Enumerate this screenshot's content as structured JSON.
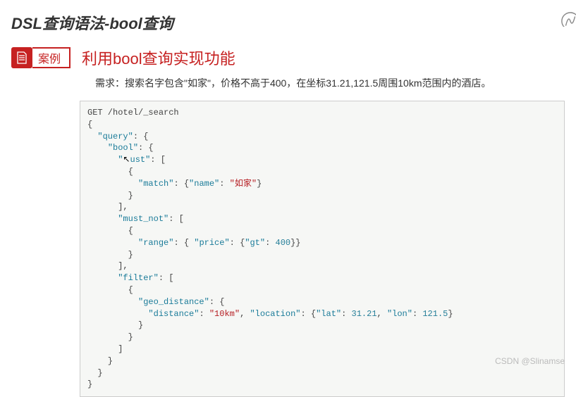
{
  "page_title": "DSL查询语法-bool查询",
  "badge_label": "案例",
  "section_title": "利用bool查询实现功能",
  "requirement": "需求：搜索名字包含\"如家\"，价格不高于400，在坐标31.21,121.5周围10km范围内的酒店。",
  "code": {
    "line01": "GET /hotel/_search",
    "query": "\"query\"",
    "bool": "\"bool\"",
    "must_raw": "\"",
    "must_a": "u",
    "must_b": "st\"",
    "match": "\"match\"",
    "name": "\"name\"",
    "name_val": "\"如家\"",
    "must_not": "\"must_not\"",
    "range": "\"range\"",
    "price": "\"price\"",
    "gt": "\"gt\"",
    "gt_val": "400",
    "filter": "\"filter\"",
    "geo_distance": "\"geo_distance\"",
    "distance": "\"distance\"",
    "distance_val": "\"10km\"",
    "location": "\"location\"",
    "lat": "\"lat\"",
    "lat_val": "31.21",
    "lon": "\"lon\"",
    "lon_val": "121.5"
  },
  "watermark": "CSDN @Slinamse"
}
